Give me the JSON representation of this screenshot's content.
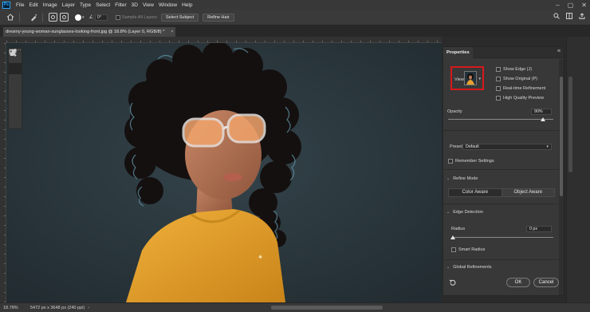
{
  "app": {
    "logo": "Ps"
  },
  "menu": [
    "File",
    "Edit",
    "Image",
    "Layer",
    "Type",
    "Select",
    "Filter",
    "3D",
    "View",
    "Window",
    "Help"
  ],
  "window_controls": {
    "minimize": "–",
    "maximize": "▢",
    "close": "✕"
  },
  "options_bar": {
    "angle_icon": "∠",
    "angle_value": "0°",
    "sample_all_layers": "Sample All Layers",
    "select_subject": "Select Subject",
    "refine_hair": "Refine Hair"
  },
  "document": {
    "tab_title": "dreamy-young-woman-sunglasses-looking-front.jpg @ 18.8% (Layer 0, RGB/8) *",
    "close": "×"
  },
  "status": {
    "zoom": "18.78%",
    "info": "5472 px x 3648 px (240 ppi)",
    "arrow": "›"
  },
  "properties": {
    "tab": "Properties",
    "menu_icon": "≡",
    "view_label": "View",
    "view_options": [
      "Show Edge (J)",
      "Show Original (P)",
      "Real-time Refinement",
      "High Quality Preview"
    ],
    "opacity_label": "Opacity",
    "opacity_value": "90%",
    "opacity_fraction": 0.9,
    "preset_label": "Preset",
    "preset_value": "Default",
    "remember_settings": "Remember Settings",
    "refine_mode_label": "Refine Mode",
    "color_aware": "Color Aware",
    "object_aware": "Object Aware",
    "edge_detection_label": "Edge Detection",
    "radius_label": "Radius",
    "radius_value": "0 px",
    "radius_fraction": 0.0,
    "smart_radius": "Smart Radius",
    "global_refinements_label": "Global Refinements",
    "ok": "OK",
    "cancel": "Cancel"
  },
  "colors": {
    "accent_highlight": "#d7191c",
    "canvas_bg": "#28353b",
    "jacket": "#e7a12f",
    "panel_bg": "#383838"
  }
}
